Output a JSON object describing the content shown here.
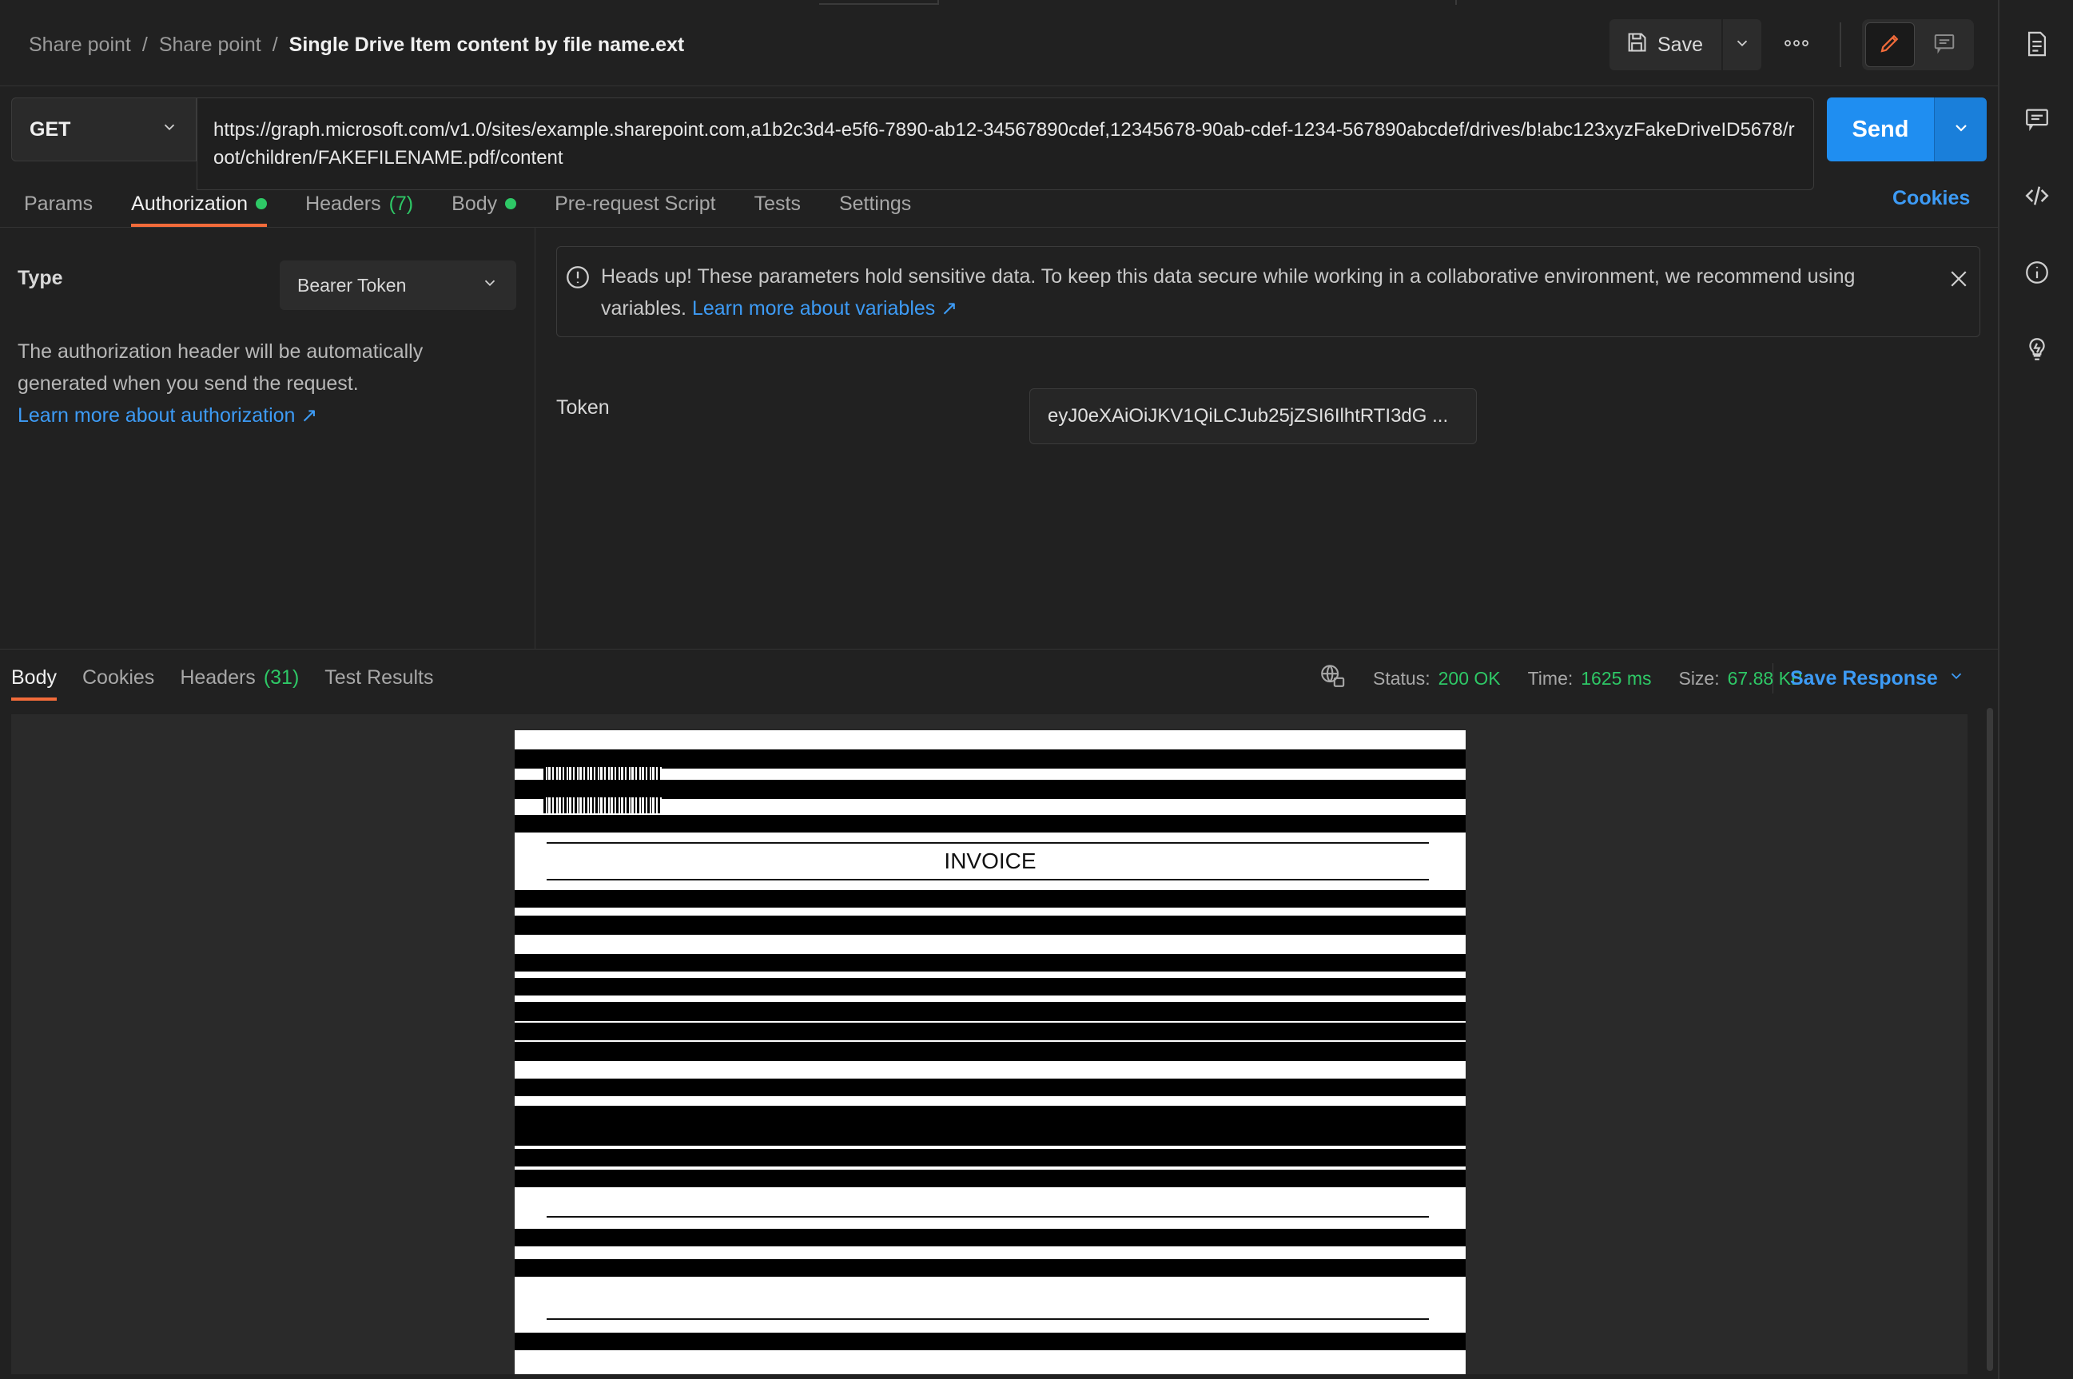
{
  "breadcrumb": {
    "items": [
      "Share point",
      "Share point"
    ],
    "separator": "/",
    "current": "Single Drive Item content by file name.ext"
  },
  "toolbar": {
    "save_label": "Save"
  },
  "request": {
    "method": "GET",
    "url": "https://graph.microsoft.com/v1.0/sites/example.sharepoint.com,a1b2c3d4-e5f6-7890-ab12-34567890cdef,12345678-90ab-cdef-1234-567890abcdef/drives/b!abc123xyzFakeDriveID5678/root/children/FAKEFILENAME.pdf/content",
    "send_label": "Send"
  },
  "request_tabs": {
    "params": "Params",
    "authorization": "Authorization",
    "headers": "Headers",
    "headers_count": "(7)",
    "body": "Body",
    "pre_request": "Pre-request Script",
    "tests": "Tests",
    "settings": "Settings",
    "cookies": "Cookies"
  },
  "auth": {
    "type_label": "Type",
    "type_value": "Bearer Token",
    "description": "The authorization header will be automatically generated when you send the request.",
    "learn_more": "Learn more about authorization ↗",
    "warning_text": "Heads up! These parameters hold sensitive data. To keep this data secure while working in a collaborative environment, we recommend using variables.",
    "warning_link": "Learn more about variables ↗",
    "token_label": "Token",
    "token_value": "eyJ0eXAiOiJKV1QiLCJub25jZSI6IlhtRTI3dG ..."
  },
  "response_tabs": {
    "body": "Body",
    "cookies": "Cookies",
    "headers": "Headers",
    "headers_count": "(31)",
    "test_results": "Test Results"
  },
  "response_status": {
    "status_label": "Status:",
    "status_value": "200 OK",
    "time_label": "Time:",
    "time_value": "1625 ms",
    "size_label": "Size:",
    "size_value": "67.88 KB",
    "save_response": "Save Response"
  },
  "document": {
    "title": "INVOICE"
  },
  "colors": {
    "accent": "#1f8ef1",
    "link": "#3d9bf5",
    "success": "#2ec866",
    "active_tab": "#f26b3a",
    "background": "#212121"
  },
  "icons": {
    "save": "floppy-disk-icon",
    "more": "ellipsis-icon",
    "edit": "pencil-icon",
    "comment": "comment-icon",
    "docs": "document-icon",
    "code": "code-icon",
    "info": "info-icon",
    "idea": "lightbulb-icon",
    "network": "globe-network-icon",
    "warning": "exclamation-circle-icon",
    "close": "close-icon"
  }
}
